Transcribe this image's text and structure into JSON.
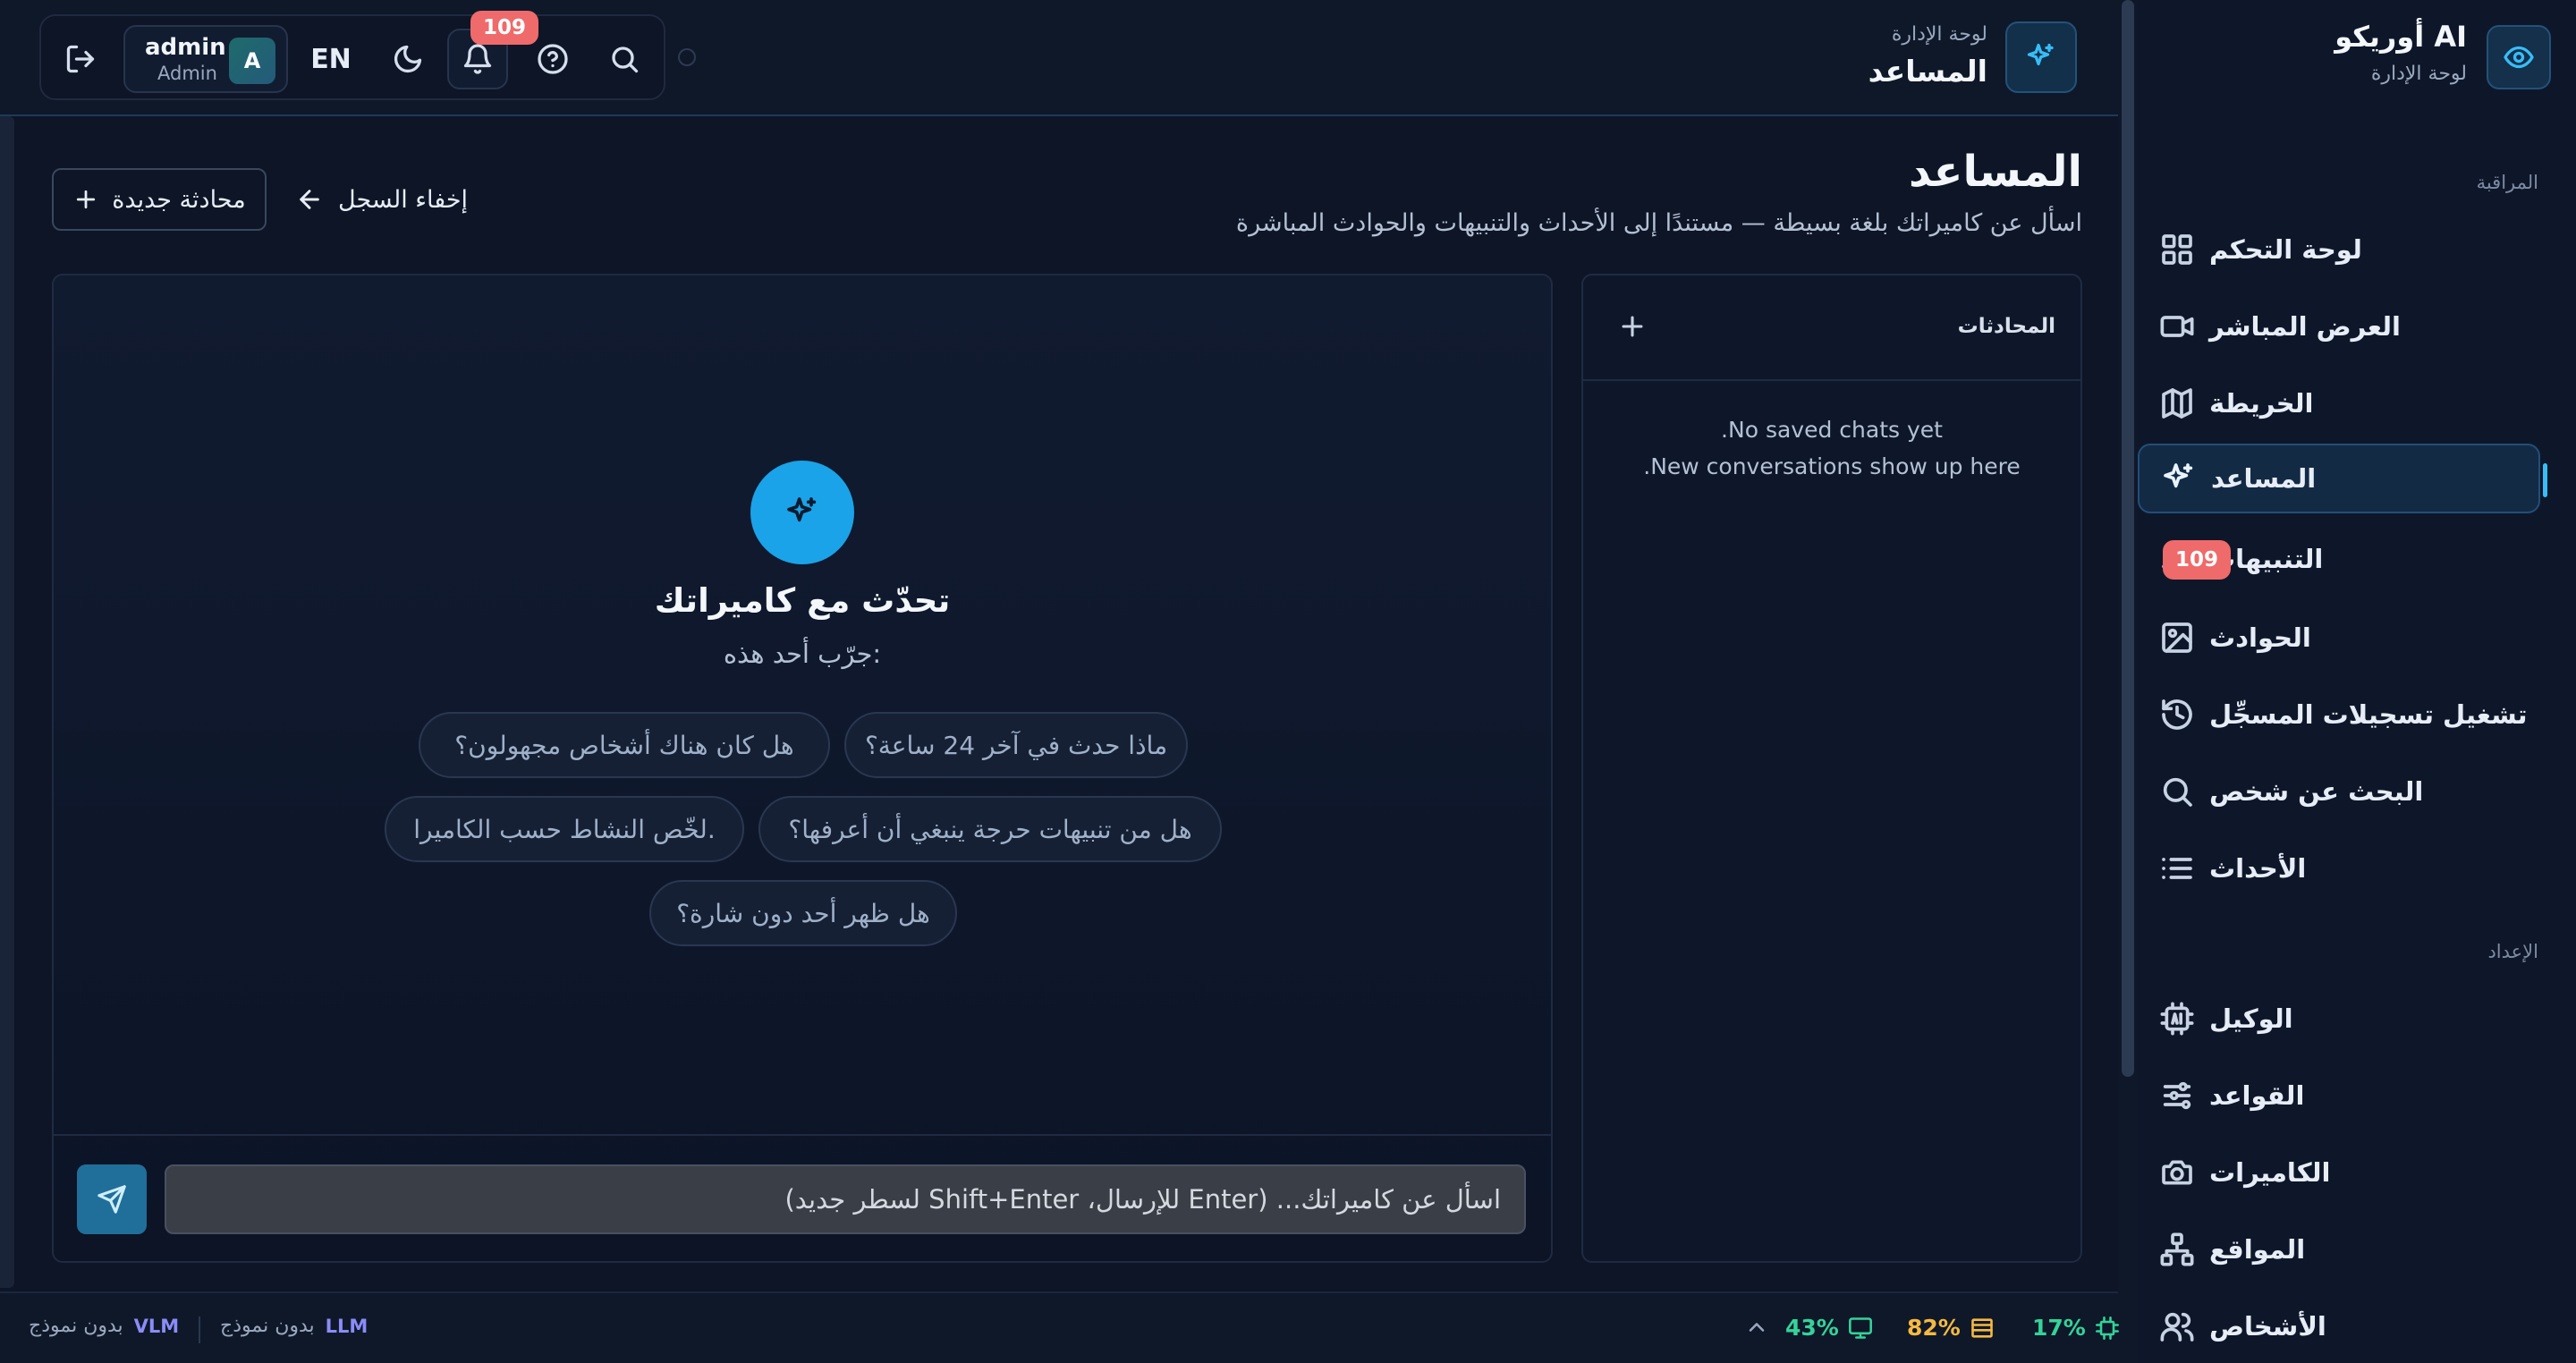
{
  "sidebar": {
    "brand_title": "أوريكو AI",
    "brand_subtitle": "لوحة الإدارة",
    "sections": {
      "monitoring": "المراقبة",
      "setup": "الإعداد"
    },
    "items": {
      "dashboard": "لوحة التحكم",
      "live": "العرض المباشر",
      "map": "الخريطة",
      "assistant": "المساعد",
      "alerts": "التنبيهات",
      "alerts_badge": "109",
      "incidents": "الحوادث",
      "playback": "تشغيل تسجيلات المسجِّل",
      "person_search": "البحث عن شخص",
      "events": "الأحداث",
      "agent": "الوكيل",
      "rules": "القواعد",
      "cameras": "الكاميرات",
      "sites": "المواقع",
      "people": "الأشخاص"
    }
  },
  "topbar": {
    "subtitle": "لوحة الإدارة",
    "title": "المساعد",
    "user_name": "admin",
    "user_role": "Admin",
    "avatar_letter": "A",
    "lang": "EN",
    "notif_badge": "109"
  },
  "page": {
    "title": "المساعد",
    "description": "اسأل عن كاميراتك بلغة بسيطة — مستندًا إلى الأحداث والتنبيهات والحوادث المباشرة",
    "new_chat": "محادثة جديدة",
    "hide_history": "إخفاء السجل"
  },
  "conversations": {
    "title": "المحادثات",
    "empty_line1": "No saved chats yet.",
    "empty_line2": "New conversations show up here."
  },
  "chat": {
    "hero_title": "تحدّث مع كاميراتك",
    "hero_subtitle": "جرّب أحد هذه:",
    "suggestions": [
      "ماذا حدث في آخر 24 ساعة؟",
      "هل كان هناك أشخاص مجهولون؟",
      "هل من تنبيهات حرجة ينبغي أن أعرفها؟",
      "لخّص النشاط حسب الكاميرا.",
      "هل ظهر أحد دون شارة؟"
    ],
    "input_placeholder": "اسأل عن كاميراتك...  (Enter للإرسال، Shift+Enter لسطر جديد)"
  },
  "statusbar": {
    "vlm_tag": "VLM",
    "vlm_value": "بدون نموذج",
    "llm_tag": "LLM",
    "llm_value": "بدون نموذج",
    "cpu": "17%",
    "memory": "82%",
    "gpu": "43%"
  },
  "colors": {
    "accent": "#1aa0e6",
    "badge": "#ef6a6a",
    "cpu": "#34d399",
    "memory": "#f5b942",
    "gpu": "#34d399",
    "model_tag": "#8b8cf8"
  }
}
